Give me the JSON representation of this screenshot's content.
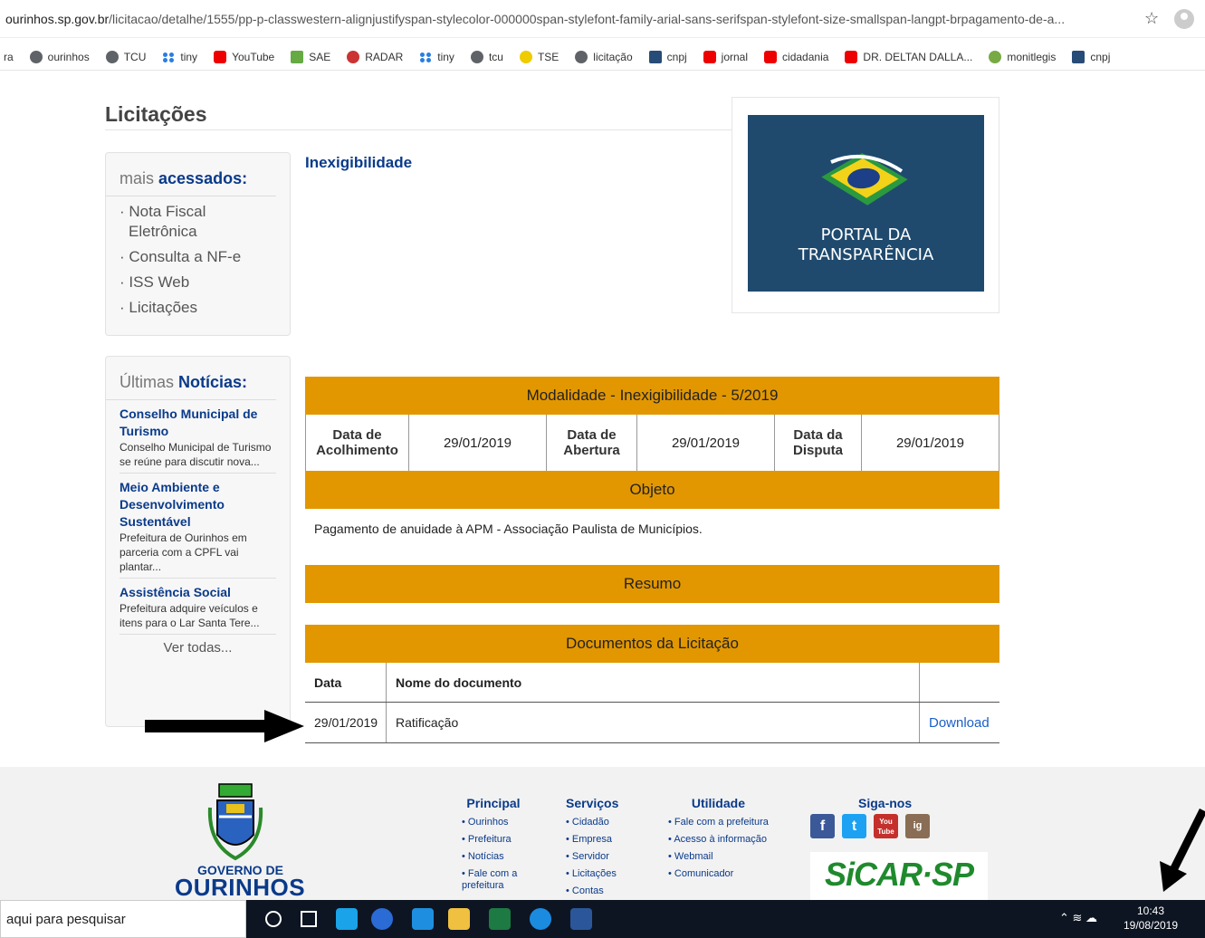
{
  "browser": {
    "url_host": "ourinhos.sp.gov.br",
    "url_path": "/licitacao/detalhe/1555/pp-p-classwestern-alignjustifyspan-stylecolor-000000span-stylefont-family-arial-sans-serifspan-stylefont-size-smallspan-langpt-brpagamento-de-a...",
    "star_icon": "☆"
  },
  "bookmarks": [
    {
      "label": "ra",
      "icon": "none"
    },
    {
      "label": "ourinhos",
      "icon": "globe"
    },
    {
      "label": "TCU",
      "icon": "globe"
    },
    {
      "label": "tiny",
      "icon": "tiny"
    },
    {
      "label": "YouTube",
      "icon": "yt"
    },
    {
      "label": "SAE",
      "icon": "sae"
    },
    {
      "label": "RADAR",
      "icon": "radar"
    },
    {
      "label": "tiny",
      "icon": "tiny"
    },
    {
      "label": "tcu",
      "icon": "globe"
    },
    {
      "label": "TSE",
      "icon": "tse"
    },
    {
      "label": "licitação",
      "icon": "globe"
    },
    {
      "label": "cnpj",
      "icon": "cnpj"
    },
    {
      "label": "jornal",
      "icon": "yt"
    },
    {
      "label": "cidadania",
      "icon": "yt"
    },
    {
      "label": "DR. DELTAN DALLA...",
      "icon": "yt"
    },
    {
      "label": "monitlegis",
      "icon": "monit"
    },
    {
      "label": "cnpj",
      "icon": "cnpj"
    }
  ],
  "page": {
    "title": "Licitações",
    "section_title": "Inexigibilidade"
  },
  "sidebar": {
    "acessados": {
      "prefix": "mais ",
      "bold": "acessados:",
      "items": [
        "· Nota Fiscal Eletrônica",
        "· Consulta a NF-e",
        "· ISS Web",
        "· Licitações"
      ]
    },
    "noticias": {
      "prefix": "Últimas ",
      "bold": "Notícias:",
      "items": [
        {
          "title": "Conselho Municipal de Turismo",
          "desc": "Conselho Municipal de Turismo se reúne para discutir nova..."
        },
        {
          "title": "Meio Ambiente e Desenvolvimento Sustentável",
          "desc": "Prefeitura de Ourinhos em parceria com a CPFL vai plantar..."
        },
        {
          "title": "Assistência Social",
          "desc": "Prefeitura adquire veículos e itens para o Lar Santa Tere..."
        }
      ],
      "ver_todas": "Ver todas..."
    }
  },
  "portal": {
    "line1": "PORTAL DA",
    "line2": "TRANSPARÊNCIA"
  },
  "licitacao": {
    "modalidade": "Modalidade - Inexigibilidade - 5/2019",
    "acolhimento_label": "Data de Acolhimento",
    "acolhimento_value": "29/01/2019",
    "abertura_label": "Data de Abertura",
    "abertura_value": "29/01/2019",
    "disputa_label": "Data da Disputa",
    "disputa_value": "29/01/2019",
    "objeto_header": "Objeto",
    "objeto_text": "Pagamento de anuidade à APM - Associação Paulista de Municípios.",
    "resumo_header": "Resumo",
    "documentos_header": "Documentos da Licitação",
    "doc_col_data": "Data",
    "doc_col_nome": "Nome do documento",
    "documents": [
      {
        "data": "29/01/2019",
        "nome": "Ratificação",
        "action": "Download"
      }
    ]
  },
  "footer": {
    "gov_de": "GOVERNO DE",
    "gov_name": "OURINHOS",
    "principal": {
      "title": "Principal",
      "items": [
        "Ourinhos",
        "Prefeitura",
        "Notícias",
        "Fale com a prefeitura"
      ]
    },
    "servicos": {
      "title": "Serviços",
      "items": [
        "Cidadão",
        "Empresa",
        "Servidor",
        "Licitações",
        "Contas"
      ]
    },
    "utilidade": {
      "title": "Utilidade",
      "items": [
        "Fale com a prefeitura",
        "Acesso à informação",
        "Webmail",
        "Comunicador"
      ]
    },
    "siga": {
      "title": "Siga-nos"
    },
    "social": [
      "f",
      "t",
      "You Tube",
      "ig"
    ],
    "sicar": "SiCAR·SP"
  },
  "taskbar": {
    "search_placeholder": "aqui para pesquisar",
    "time": "10:43",
    "date": "19/08/2019"
  },
  "colors": {
    "accent_orange": "#e29700",
    "link_blue": "#0a3a8a",
    "portal_bg": "#1f4a6e"
  }
}
